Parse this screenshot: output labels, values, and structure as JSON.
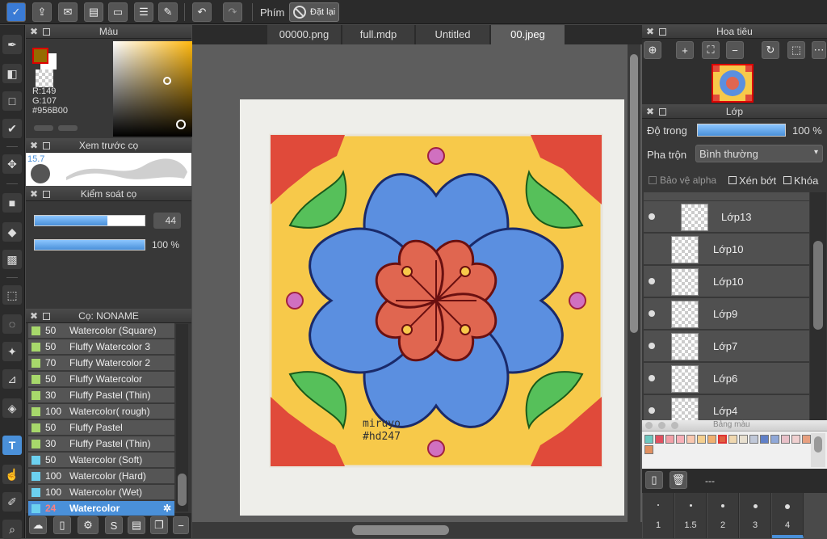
{
  "toolbar": {
    "shortcut_label": "Phím",
    "reset_label": "Đặt lại"
  },
  "tabs": [
    {
      "label": "00000.png"
    },
    {
      "label": "full.mdp"
    },
    {
      "label": "Untitled"
    },
    {
      "label": "00.jpeg"
    }
  ],
  "color_panel": {
    "title": "Màu",
    "r": "R:149",
    "g": "G:107",
    "hex": "#956B00",
    "fg_color": "#956b00"
  },
  "brush_preview": {
    "title": "Xem trước cọ",
    "size": "15.7"
  },
  "brush_control": {
    "title": "Kiểm soát cọ",
    "size_value": "44",
    "size_level": 0.66,
    "opacity_value": "100 %",
    "opacity_level": 1.0
  },
  "brush_list": {
    "title": "Cọ: NONAME",
    "items": [
      {
        "size": "50",
        "name": "Watercolor (Square)",
        "color": "#a7d86b"
      },
      {
        "size": "50",
        "name": "Fluffy Watercolor 3",
        "color": "#a7d86b"
      },
      {
        "size": "70",
        "name": "Fluffy Watercolor 2",
        "color": "#a7d86b"
      },
      {
        "size": "50",
        "name": "Fluffy Watercolor",
        "color": "#a7d86b"
      },
      {
        "size": "30",
        "name": "Fluffy Pastel (Thin)",
        "color": "#a7d86b"
      },
      {
        "size": "100",
        "name": "Watercolor( rough)",
        "color": "#a7d86b"
      },
      {
        "size": "50",
        "name": "Fluffy Pastel",
        "color": "#a7d86b"
      },
      {
        "size": "30",
        "name": "Fluffy Pastel (Thin)",
        "color": "#a7d86b"
      },
      {
        "size": "50",
        "name": "Watercolor (Soft)",
        "color": "#6cd1f0"
      },
      {
        "size": "100",
        "name": "Watercolor (Hard)",
        "color": "#6cd1f0"
      },
      {
        "size": "100",
        "name": "Watercolor (Wet)",
        "color": "#6cd1f0"
      },
      {
        "size": "24",
        "name": "Watercolor",
        "color": "#6cd1f0",
        "selected": true
      }
    ]
  },
  "canvas": {
    "watermark_line1": "miruyo",
    "watermark_line2": "#hd247"
  },
  "navigator": {
    "title": "Hoa tiêu"
  },
  "layers": {
    "title": "Lớp",
    "opacity_label": "Độ trong",
    "opacity_value": "100 %",
    "opacity_level": 1.0,
    "blend_label": "Pha trộn",
    "blend_value": "Bình thường",
    "protect_alpha": "Bảo vệ alpha",
    "clipping": "Xén bớt",
    "lock": "Khóa",
    "footer_name": "---",
    "items": [
      {
        "name": "Lớp13",
        "visible": true
      },
      {
        "name": "Lớp10",
        "visible": false
      },
      {
        "name": "Lớp10",
        "visible": true
      },
      {
        "name": "Lớp9",
        "visible": true
      },
      {
        "name": "Lớp7",
        "visible": true
      },
      {
        "name": "Lớp6",
        "visible": true
      },
      {
        "name": "Lớp4",
        "visible": true
      }
    ]
  },
  "palette": {
    "title": "Bảng màu",
    "colors": [
      "#6cc9c0",
      "#e05060",
      "#f2a0a8",
      "#f7b0b8",
      "#f9c8b0",
      "#f5d090",
      "#f0b070",
      "#e06040",
      "#f0d8b0",
      "#e8e0d0",
      "#c0c8d8",
      "#6080c8",
      "#90a8d8",
      "#e8c0c8",
      "#f0d0d0",
      "#e8a080",
      "#e09060"
    ]
  },
  "pen_sizes": [
    "1",
    "1.5",
    "2",
    "3",
    "4"
  ]
}
